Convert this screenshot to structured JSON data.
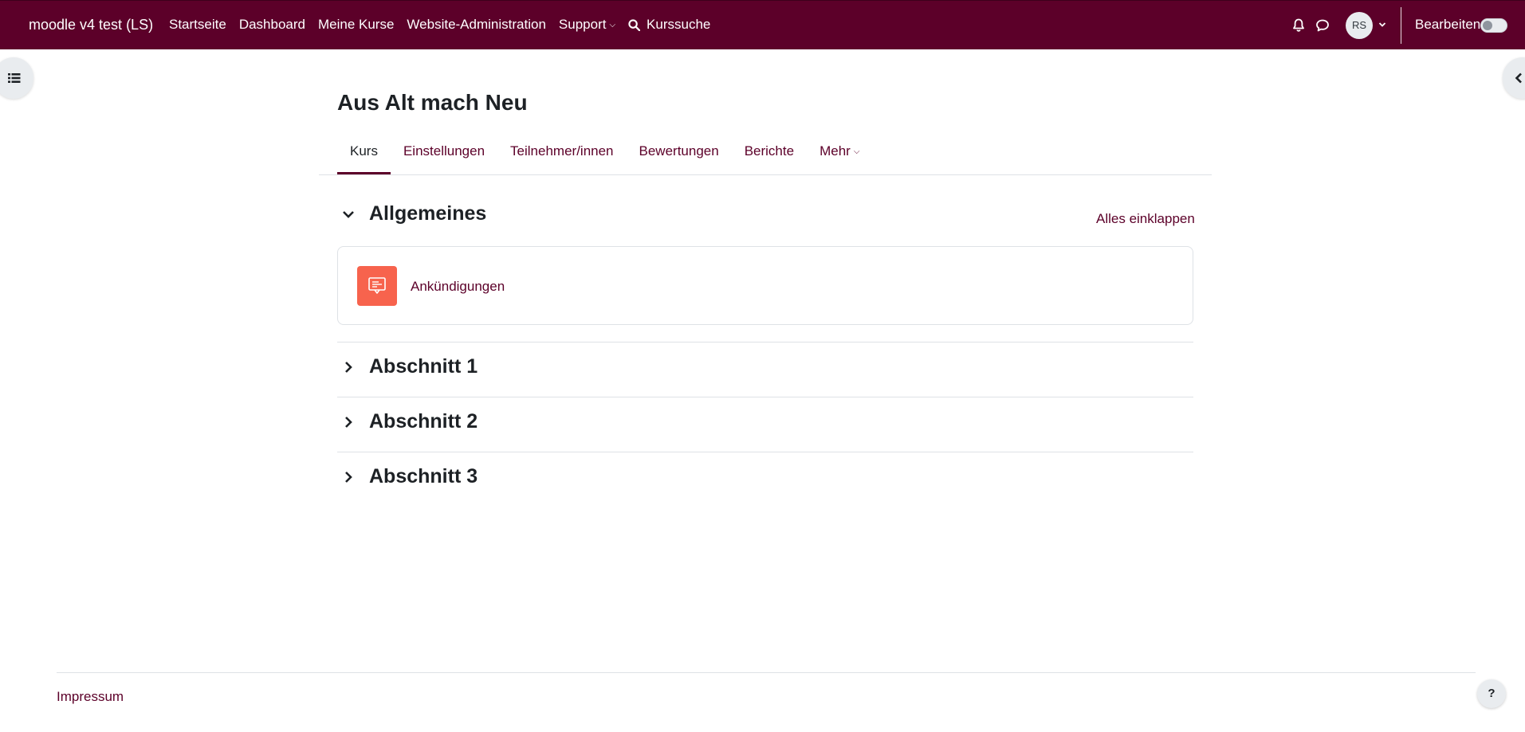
{
  "navbar": {
    "site_name": "moodle v4 test (LS)",
    "links": {
      "home": "Startseite",
      "dashboard": "Dashboard",
      "my_courses": "Meine Kurse",
      "site_admin": "Website-Administration",
      "support": "Support",
      "course_search": "Kurssuche"
    },
    "user_initials": "RS",
    "edit_mode_label": "Bearbeiten",
    "edit_mode_on": false
  },
  "page": {
    "title": "Aus Alt mach Neu"
  },
  "secondary_nav": {
    "tabs": [
      "Kurs",
      "Einstellungen",
      "Teilnehmer/innen",
      "Bewertungen",
      "Berichte",
      "Mehr"
    ],
    "active": "Kurs"
  },
  "course": {
    "collapse_all": "Alles einklappen",
    "sections": [
      {
        "title": "Allgemeines",
        "expanded": true,
        "activities": [
          {
            "name": "Ankündigungen",
            "type": "forum"
          }
        ]
      },
      {
        "title": "Abschnitt 1",
        "expanded": false
      },
      {
        "title": "Abschnitt 2",
        "expanded": false
      },
      {
        "title": "Abschnitt 3",
        "expanded": false
      }
    ]
  },
  "footer": {
    "impressum": "Impressum",
    "help": "?"
  },
  "colors": {
    "brand": "#5c0029",
    "forum_icon_bg": "#f7634d",
    "border": "#dee2e6"
  },
  "icons": {
    "search": "search-icon",
    "notifications": "bell-icon",
    "messages": "chat-bubble-icon",
    "course_index": "list-icon",
    "block_drawer": "chevron-left-icon",
    "forum": "forum-icon"
  }
}
